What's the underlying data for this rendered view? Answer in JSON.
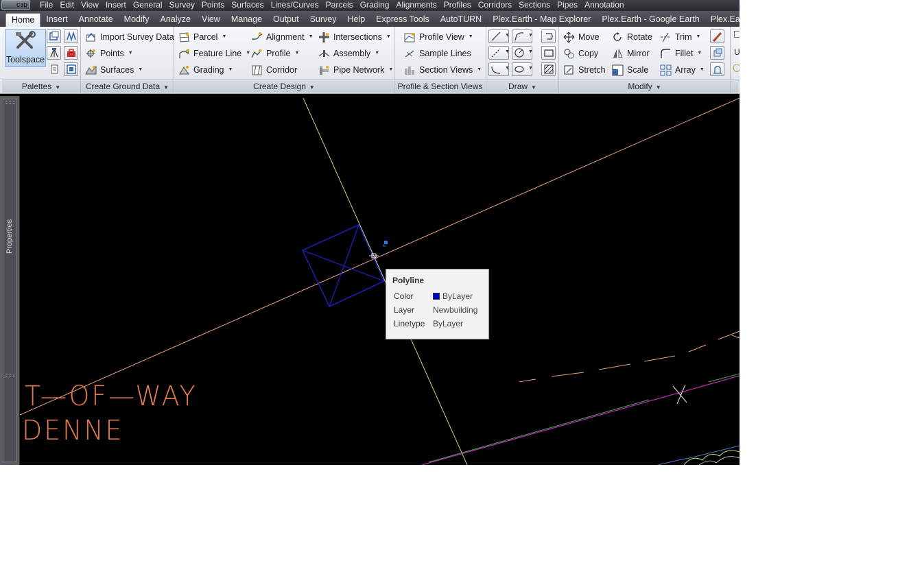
{
  "app": {
    "logo": "C3D"
  },
  "menu": [
    "File",
    "Edit",
    "View",
    "Insert",
    "General",
    "Survey",
    "Points",
    "Surfaces",
    "Lines/Curves",
    "Parcels",
    "Grading",
    "Alignments",
    "Profiles",
    "Corridors",
    "Sections",
    "Pipes",
    "Annotation"
  ],
  "tabs": [
    "Home",
    "Insert",
    "Annotate",
    "Modify",
    "Analyze",
    "View",
    "Manage",
    "Output",
    "Survey",
    "Help",
    "Express Tools",
    "AutoTURN",
    "Plex.Earth - Map Explorer",
    "Plex.Earth - Google Earth",
    "Plex.Earth"
  ],
  "active_tab": "Home",
  "ribbon": {
    "palettes": {
      "title": "Palettes",
      "toolspace": "Toolspace"
    },
    "ground": {
      "title": "Create Ground Data",
      "import_survey": "Import Survey Data",
      "points": "Points",
      "surfaces": "Surfaces"
    },
    "design": {
      "title": "Create Design",
      "parcel": "Parcel",
      "feature_line": "Feature Line",
      "grading": "Grading",
      "alignment": "Alignment",
      "profile": "Profile",
      "corridor": "Corridor",
      "intersections": "Intersections",
      "assembly": "Assembly",
      "pipe_network": "Pipe Network"
    },
    "profile_views": {
      "title": "Profile & Section Views",
      "profile_view": "Profile View",
      "sample_lines": "Sample Lines",
      "section_views": "Section Views"
    },
    "draw": {
      "title": "Draw"
    },
    "modify": {
      "title": "Modify",
      "move": "Move",
      "copy": "Copy",
      "stretch": "Stretch",
      "rotate": "Rotate",
      "mirror": "Mirror",
      "scale": "Scale",
      "trim": "Trim",
      "fillet": "Fillet",
      "array": "Array"
    },
    "next_panel": {
      "label": "U"
    }
  },
  "side_palette": {
    "label": "Properties"
  },
  "drawing": {
    "text_line1": "T—OF—WAY",
    "text_line2": "DENNE",
    "colors": {
      "row_line": "#e8a27a",
      "cl_line": "#c8d87a",
      "building": "#2020c8",
      "pink": "#c02ac0",
      "green": "#4ca84c"
    }
  },
  "tooltip": {
    "title": "Polyline",
    "rows": [
      {
        "key": "Color",
        "value": "ByLayer",
        "swatch": "#0000cc"
      },
      {
        "key": "Layer",
        "value": "Newbuilding"
      },
      {
        "key": "Linetype",
        "value": "ByLayer"
      }
    ]
  }
}
